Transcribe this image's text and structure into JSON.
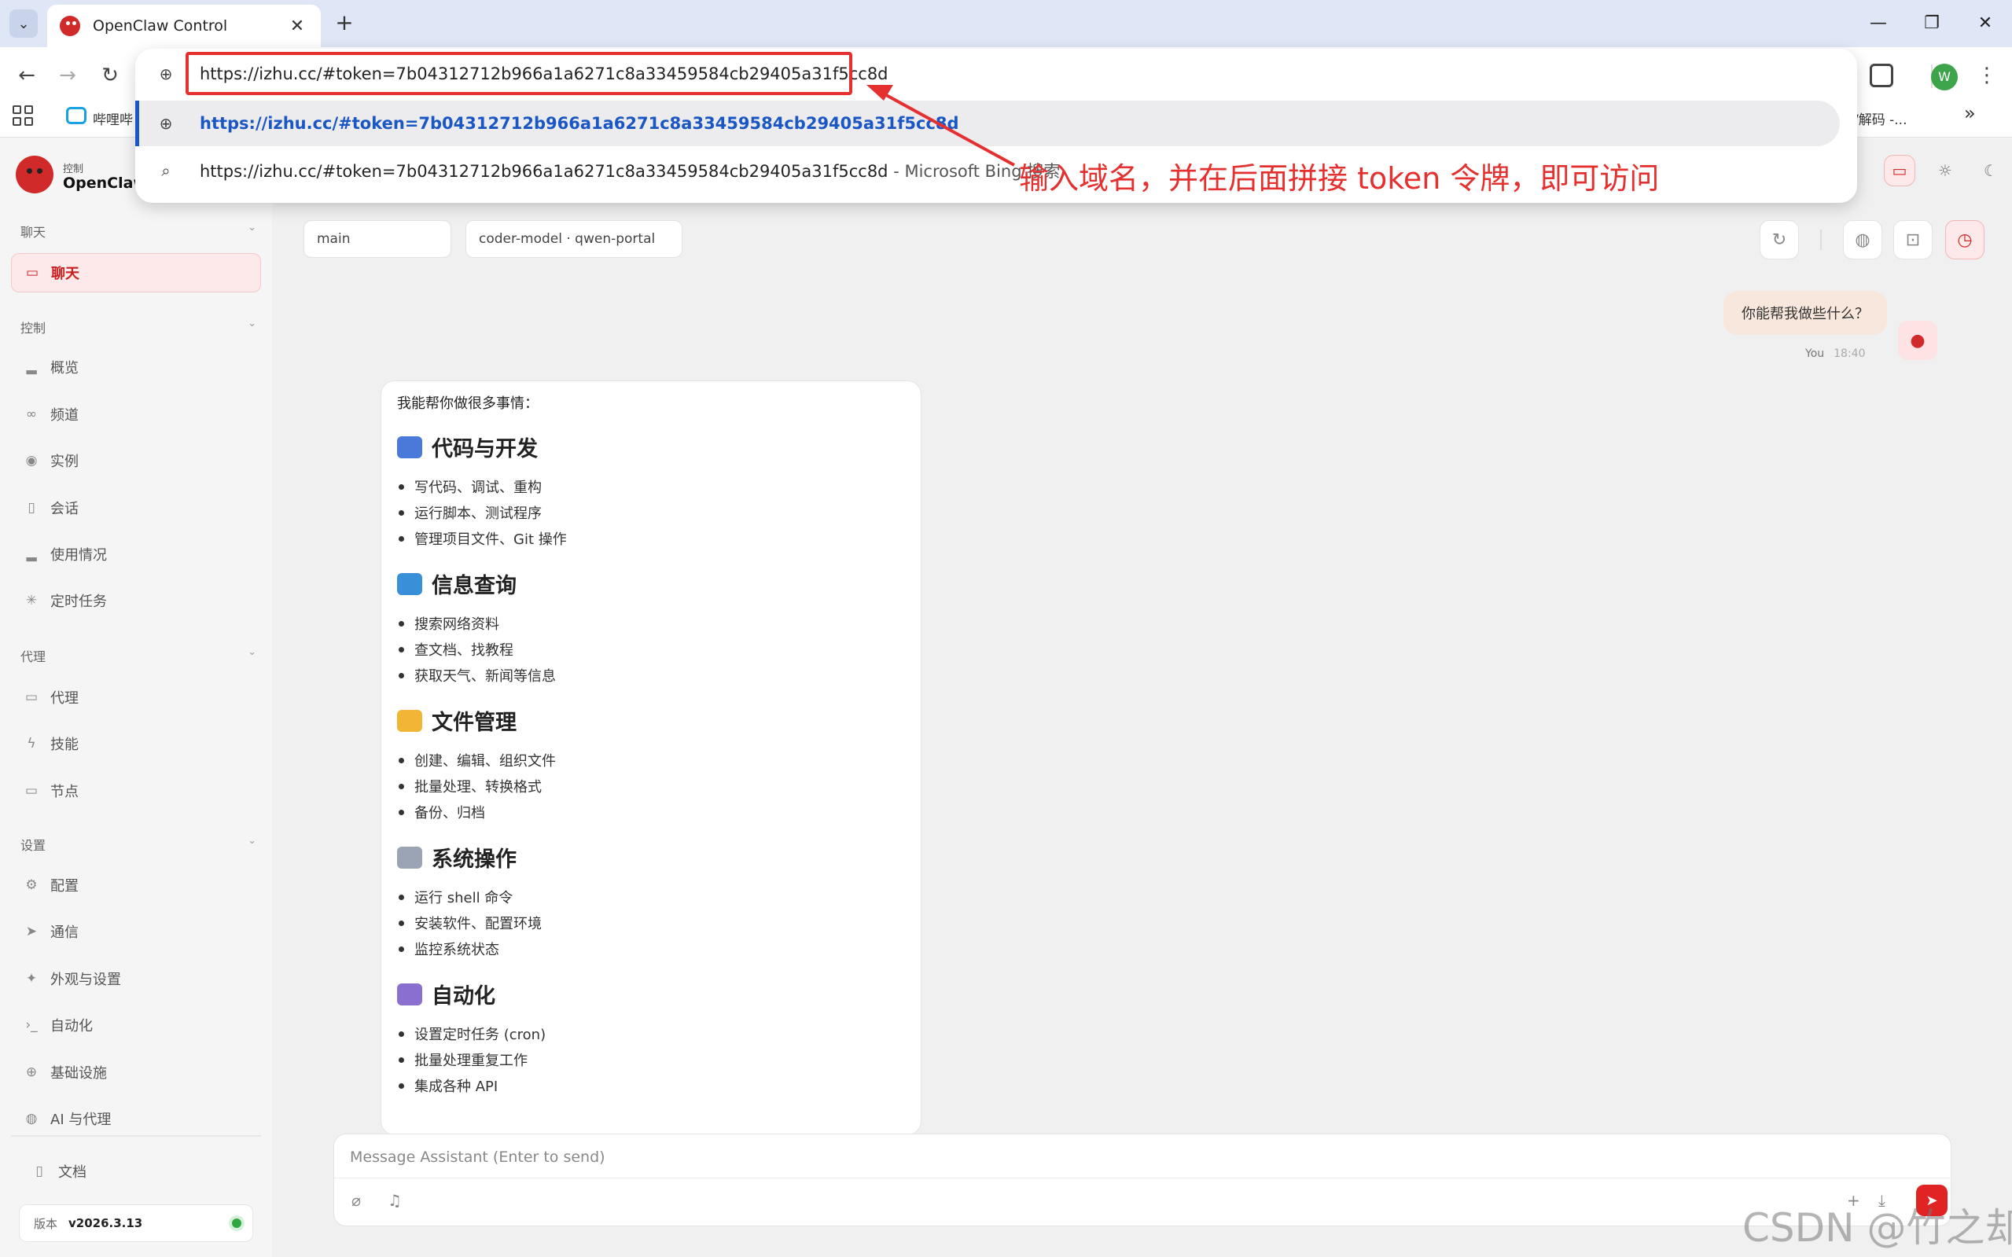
{
  "browser": {
    "tab_title": "OpenClaw Control",
    "tab_close": "✕",
    "new_tab": "+",
    "window": {
      "minimize": "—",
      "restore": "❐",
      "close": "✕"
    },
    "nav": {
      "back": "←",
      "forward": "→",
      "reload": "↻"
    },
    "profile_initial": "W",
    "menu": "⋮",
    "bookmarks": [
      {
        "label": "哔哩哔"
      },
      {
        "label": "/解码 -..."
      }
    ],
    "bookmarks_more": "»",
    "omnibox": {
      "input_value": "https://izhu.cc/#token=7b04312712b966a1a6271c8a33459584cb29405a31f5cc8d",
      "suggestion_url": "https://izhu.cc/#token=7b04312712b966a1a6271c8a33459584cb29405a31f5cc8d",
      "search_text": "https://izhu.cc/#token=7b04312712b966a1a6271c8a33459584cb29405a31f5cc8d",
      "search_suffix": " - Microsoft Bing 搜索"
    }
  },
  "annotation": "输入域名，并在后面拼接 token 令牌，即可访问",
  "sidebar": {
    "brand_sub": "控制",
    "brand_title": "OpenClaw",
    "sections": [
      {
        "title": "聊天",
        "items": [
          {
            "label": "聊天",
            "icon": "chat-icon",
            "active": true
          }
        ]
      },
      {
        "title": "控制",
        "items": [
          {
            "label": "概览",
            "icon": "bar-chart-icon"
          },
          {
            "label": "频道",
            "icon": "link-icon"
          },
          {
            "label": "实例",
            "icon": "radio-icon"
          },
          {
            "label": "会话",
            "icon": "document-icon"
          },
          {
            "label": "使用情况",
            "icon": "bar-chart-icon"
          },
          {
            "label": "定时任务",
            "icon": "loader-icon"
          }
        ]
      },
      {
        "title": "代理",
        "items": [
          {
            "label": "代理",
            "icon": "folder-icon"
          },
          {
            "label": "技能",
            "icon": "zap-icon"
          },
          {
            "label": "节点",
            "icon": "monitor-icon"
          }
        ]
      },
      {
        "title": "设置",
        "items": [
          {
            "label": "配置",
            "icon": "gear-icon"
          },
          {
            "label": "通信",
            "icon": "send-icon"
          },
          {
            "label": "外观与设置",
            "icon": "sparkle-icon"
          },
          {
            "label": "自动化",
            "icon": "terminal-icon"
          },
          {
            "label": "基础设施",
            "icon": "globe-icon"
          },
          {
            "label": "AI 与代理",
            "icon": "brain-icon"
          }
        ]
      }
    ],
    "docs_label": "文档",
    "version_label": "版本",
    "version_value": "v2026.3.13"
  },
  "chat": {
    "session_pill": "main",
    "model_pill": "coder-model · qwen-portal",
    "user_message": "你能帮我做些什么？",
    "user_name": "You",
    "user_time": "18:40",
    "assistant_intro": "我能帮你做很多事情：",
    "assistant_sections": [
      {
        "title": "代码与开发",
        "icon": "laptop-emoji",
        "color": "#4a7ad9",
        "items": [
          "写代码、调试、重构",
          "运行脚本、测试程序",
          "管理项目文件、Git 操作"
        ]
      },
      {
        "title": "信息查询",
        "icon": "magnifier-emoji",
        "color": "#3a8fd9",
        "items": [
          "搜索网络资料",
          "查文档、找教程",
          "获取天气、新闻等信息"
        ]
      },
      {
        "title": "文件管理",
        "icon": "folder-emoji",
        "color": "#f2b636",
        "items": [
          "创建、编辑、组织文件",
          "批量处理、转换格式",
          "备份、归档"
        ]
      },
      {
        "title": "系统操作",
        "icon": "gear-emoji",
        "color": "#9aa4b5",
        "items": [
          "运行 shell 命令",
          "安装软件、配置环境",
          "监控系统状态"
        ]
      },
      {
        "title": "自动化",
        "icon": "robot-emoji",
        "color": "#8a6fd0",
        "items": [
          "设置定时任务 (cron)",
          "批量处理重复工作",
          "集成各种 API"
        ]
      }
    ],
    "composer_placeholder": "Message Assistant (Enter to send)"
  },
  "watermark": "CSDN @竹之却",
  "colors": {
    "accent": "#d02a2a",
    "annotation": "#e53030",
    "link": "#1a56c4"
  }
}
